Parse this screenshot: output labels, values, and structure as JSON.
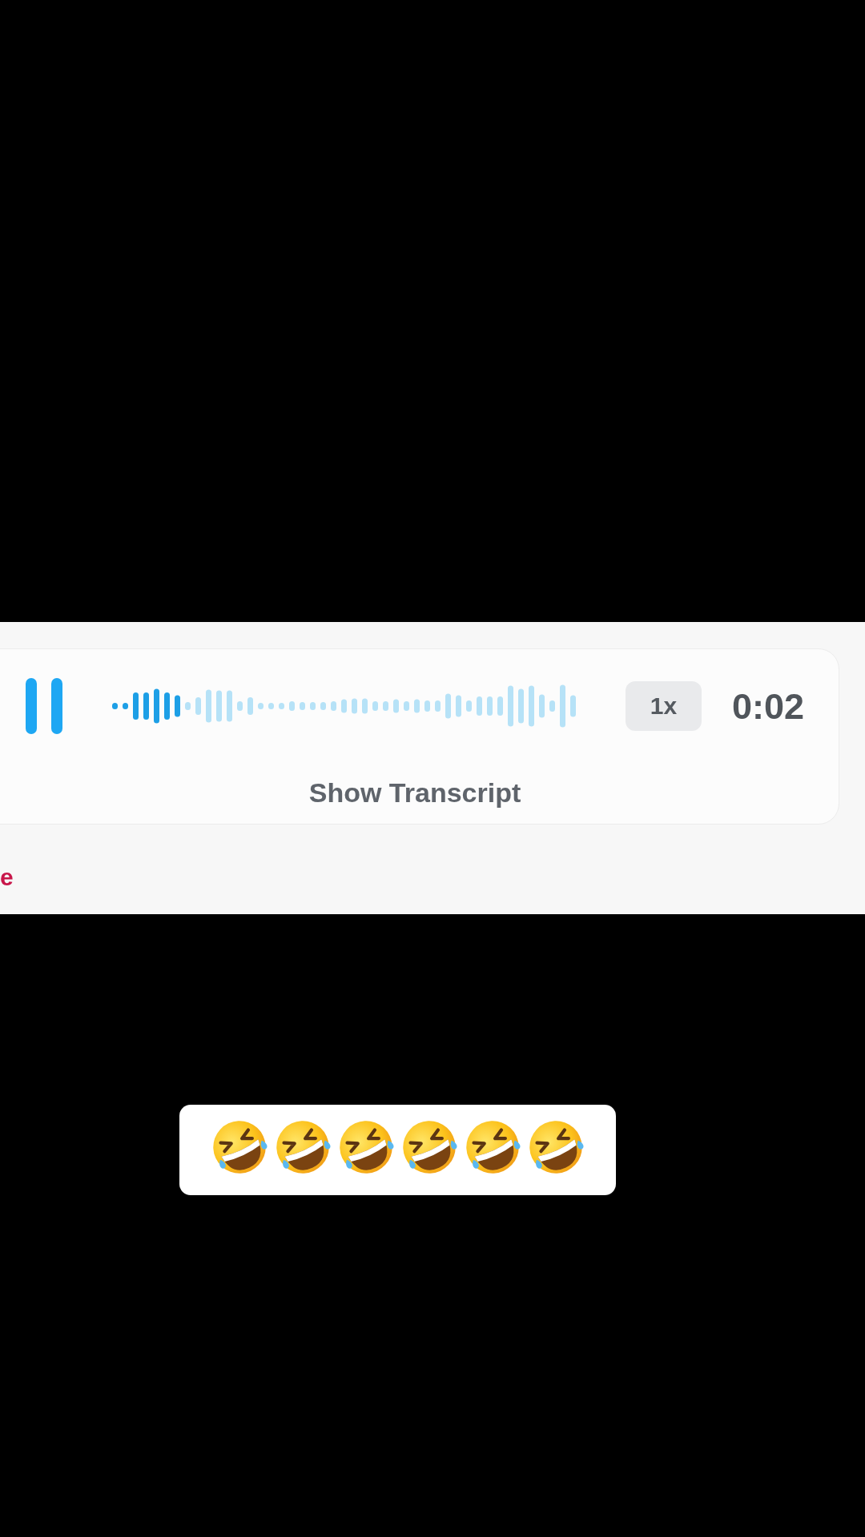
{
  "player": {
    "playing": true,
    "waveform": {
      "level": 0.15
    },
    "speed": "1x",
    "time": "0:02",
    "transcript_button": "Show Transcript"
  },
  "partial_text": "e",
  "caption": {
    "emojis": [
      {
        "kind": "rolling-laughing"
      },
      {
        "kind": "rolling-laughing"
      },
      {
        "kind": "rolling-laughing"
      },
      {
        "kind": "rolling-laughing"
      },
      {
        "kind": "rolling-laughing"
      },
      {
        "kind": "rolling-laughing"
      }
    ]
  }
}
